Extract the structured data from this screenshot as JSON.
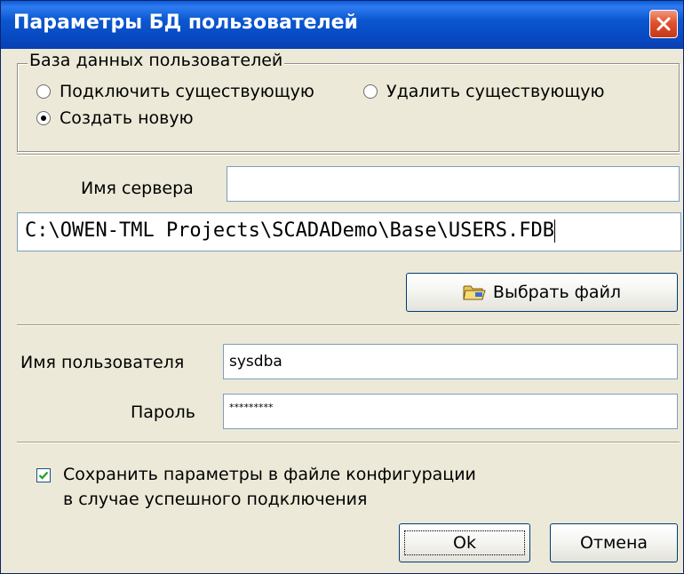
{
  "window": {
    "title": "Параметры БД пользователей",
    "close_label": "×"
  },
  "db_group": {
    "legend": "База данных пользователей",
    "options": [
      {
        "label": "Подключить существующую",
        "selected": false
      },
      {
        "label": "Удалить существующую",
        "selected": false
      },
      {
        "label": "Создать новую",
        "selected": true
      }
    ]
  },
  "server": {
    "label": "Имя сервера",
    "value": ""
  },
  "db_path": {
    "value": "C:\\OWEN-TML Projects\\SCADADemo\\Base\\USERS.FDB"
  },
  "choose_file": {
    "label": "Выбрать файл",
    "icon": "folder-icon"
  },
  "user": {
    "label": "Имя пользователя",
    "value": "sysdba"
  },
  "password": {
    "label": "Пароль",
    "value": "*********"
  },
  "save_option": {
    "line1": "Сохранить параметры в файле конфигурации",
    "line2": "в случае успешного подключения",
    "checked": true
  },
  "buttons": {
    "ok": "Ok",
    "cancel": "Отмена"
  },
  "colors": {
    "titlebar": "#0b57d0",
    "dialog_bg": "#ece9d8",
    "close": "#e0522c"
  }
}
